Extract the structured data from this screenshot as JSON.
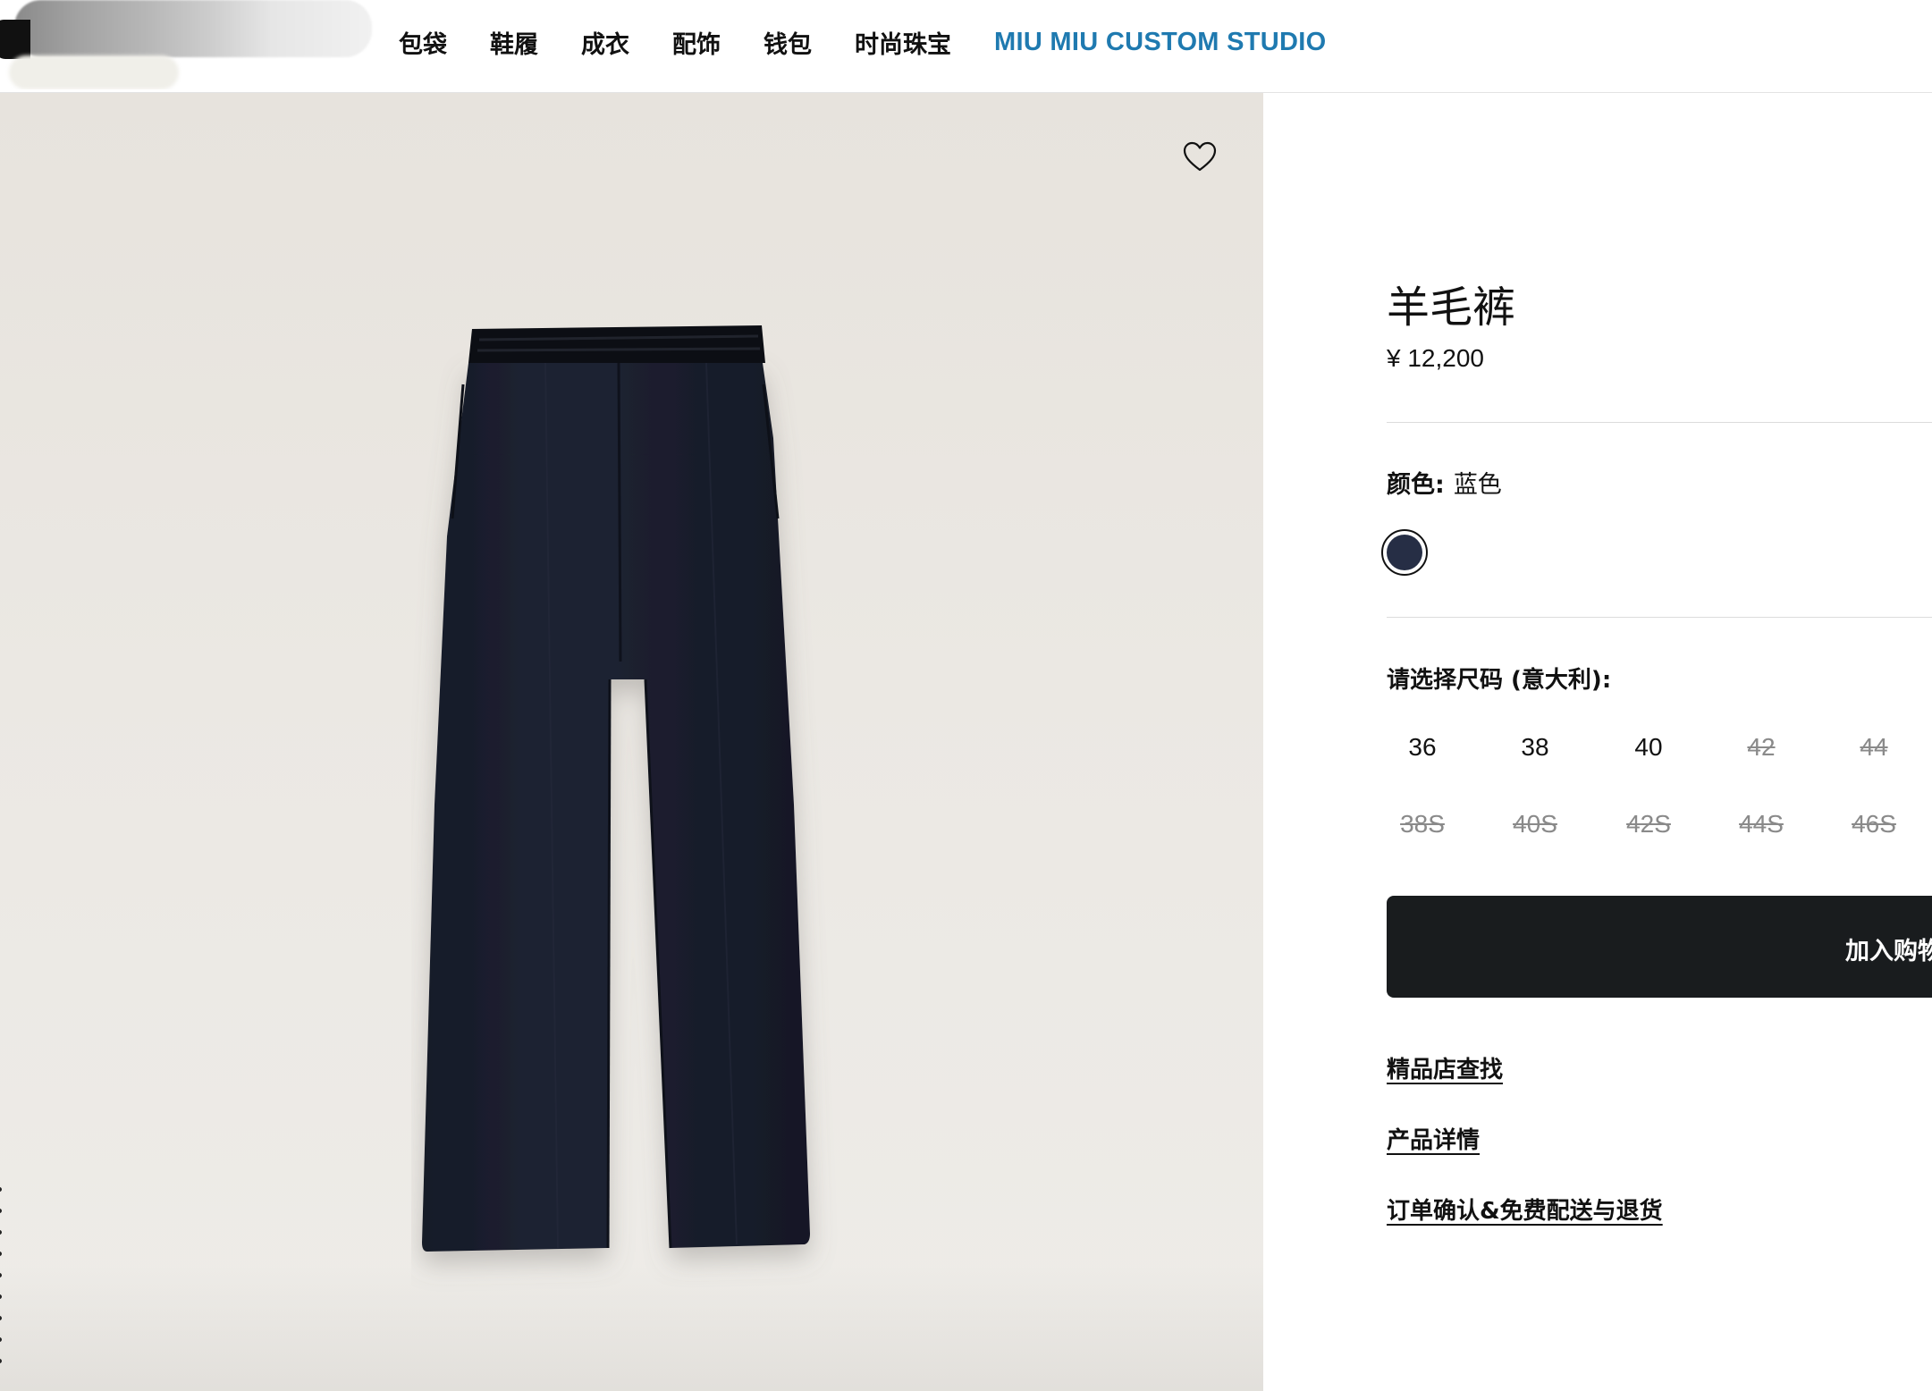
{
  "header": {
    "nav": [
      "包袋",
      "鞋履",
      "成衣",
      "配饰",
      "钱包",
      "时尚珠宝"
    ],
    "studio_label": "MIU MIU CUSTOM STUDIO"
  },
  "gallery": {
    "icons": [
      "heart-icon"
    ]
  },
  "product": {
    "title": "羊毛裤",
    "price": "¥ 12,200",
    "color_label": "颜色:",
    "color_value": "蓝色",
    "swatch_color": "#262e45",
    "size_title": "请选择尺码 (意大利):",
    "sizes_row1": [
      {
        "label": "36",
        "available": true
      },
      {
        "label": "38",
        "available": true
      },
      {
        "label": "40",
        "available": true
      },
      {
        "label": "42",
        "available": false
      },
      {
        "label": "44",
        "available": false
      }
    ],
    "sizes_row2": [
      {
        "label": "38S",
        "available": false
      },
      {
        "label": "40S",
        "available": false
      },
      {
        "label": "42S",
        "available": false
      },
      {
        "label": "44S",
        "available": false
      },
      {
        "label": "46S",
        "available": false
      }
    ],
    "add_to_cart": "加入购物",
    "links": [
      "精品店查找",
      "产品详情",
      "订单确认&免费配送与退货"
    ]
  },
  "colors": {
    "studio_blue": "#1f7ab0",
    "cart_bg": "#191c1e",
    "pants": "#1b1f2e"
  }
}
